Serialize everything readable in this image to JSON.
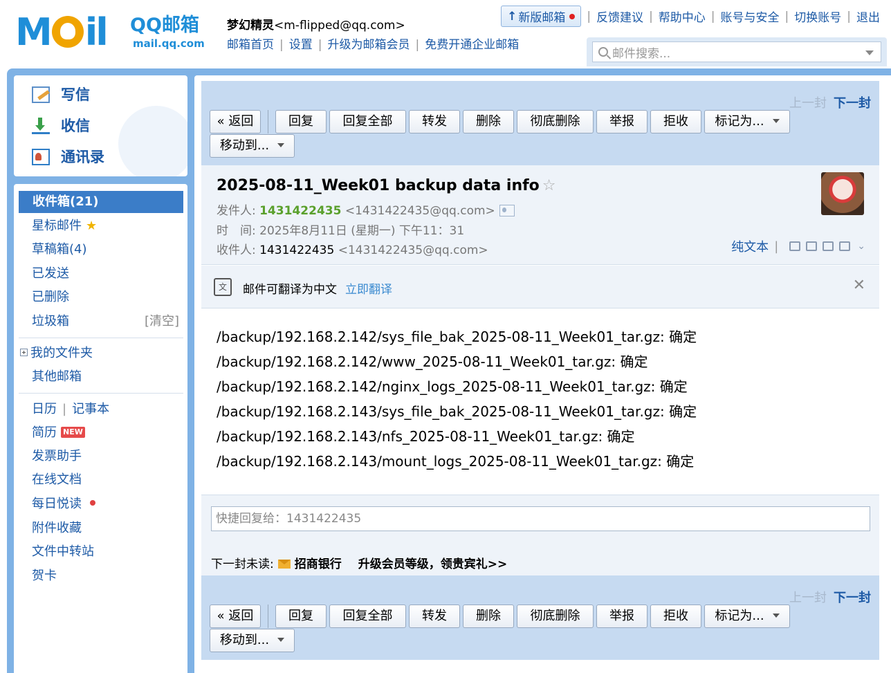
{
  "header": {
    "logo_text": "MOil",
    "logo_brand": "QQ邮箱",
    "logo_url": "mail.qq.com",
    "user_name": "梦幻精灵",
    "user_email": "<m-flipped@qq.com>",
    "nav": [
      "邮箱首页",
      "设置",
      "升级为邮箱会员",
      "免费开通企业邮箱"
    ],
    "new_mail_label": "新版邮箱",
    "top_links": [
      "反馈建议",
      "帮助中心",
      "账号与安全",
      "切换账号",
      "退出"
    ],
    "search_placeholder": "邮件搜索..."
  },
  "sidebar": {
    "compose": [
      "写信",
      "收信",
      "通讯录"
    ],
    "inbox": "收件箱(21)",
    "folders": [
      "星标邮件",
      "草稿箱(4)",
      "已发送",
      "已删除",
      "垃圾箱"
    ],
    "trash_clear": "[清空]",
    "my_folders": "我的文件夹",
    "other_mailbox": "其他邮箱",
    "calendar": "日历",
    "notebook": "记事本",
    "apps": [
      "简历",
      "发票助手",
      "在线文档",
      "每日悦读",
      "附件收藏",
      "文件中转站",
      "贺卡"
    ],
    "new_badge": "NEW"
  },
  "toolbar": {
    "prev": "上一封",
    "next": "下一封",
    "back": "« 返回",
    "reply": "回复",
    "reply_all": "回复全部",
    "forward": "转发",
    "delete": "删除",
    "delete_forever": "彻底删除",
    "report": "举报",
    "reject": "拒收",
    "mark_as": "标记为...",
    "move_to": "移动到..."
  },
  "mail": {
    "subject": "2025-08-11_Week01 backup data info",
    "from_label": "发件人:",
    "from_name": "1431422435",
    "from_email": "<1431422435@qq.com>",
    "time_label": "时　间:",
    "time": "2025年8月11日 (星期一) 下午11：31",
    "to_label": "收件人:",
    "to_name": "1431422435",
    "to_email": "<1431422435@qq.com>",
    "plain_text": "纯文本",
    "translate_text": "邮件可翻译为中文",
    "translate_link": "立即翻译",
    "translate_icon_text": "文",
    "body": [
      "/backup/192.168.2.142/sys_file_bak_2025-08-11_Week01_tar.gz: 确定",
      "/backup/192.168.2.142/www_2025-08-11_Week01_tar.gz: 确定",
      "/backup/192.168.2.142/nginx_logs_2025-08-11_Week01_tar.gz: 确定",
      "/backup/192.168.2.143/sys_file_bak_2025-08-11_Week01_tar.gz: 确定",
      "/backup/192.168.2.143/nfs_2025-08-11_Week01_tar.gz: 确定",
      "/backup/192.168.2.143/mount_logs_2025-08-11_Week01_tar.gz: 确定"
    ],
    "quick_reply_placeholder": "快捷回复给：1431422435",
    "next_unread_label": "下一封未读:",
    "next_unread_from": "招商银行",
    "next_unread_subject": "升级会员等级，领贵宾礼>>"
  },
  "colors": {
    "accent": "#1d5aa6",
    "frame": "#7fb2e5",
    "toolbar": "#c6daf1",
    "active": "#3b7dc8"
  }
}
